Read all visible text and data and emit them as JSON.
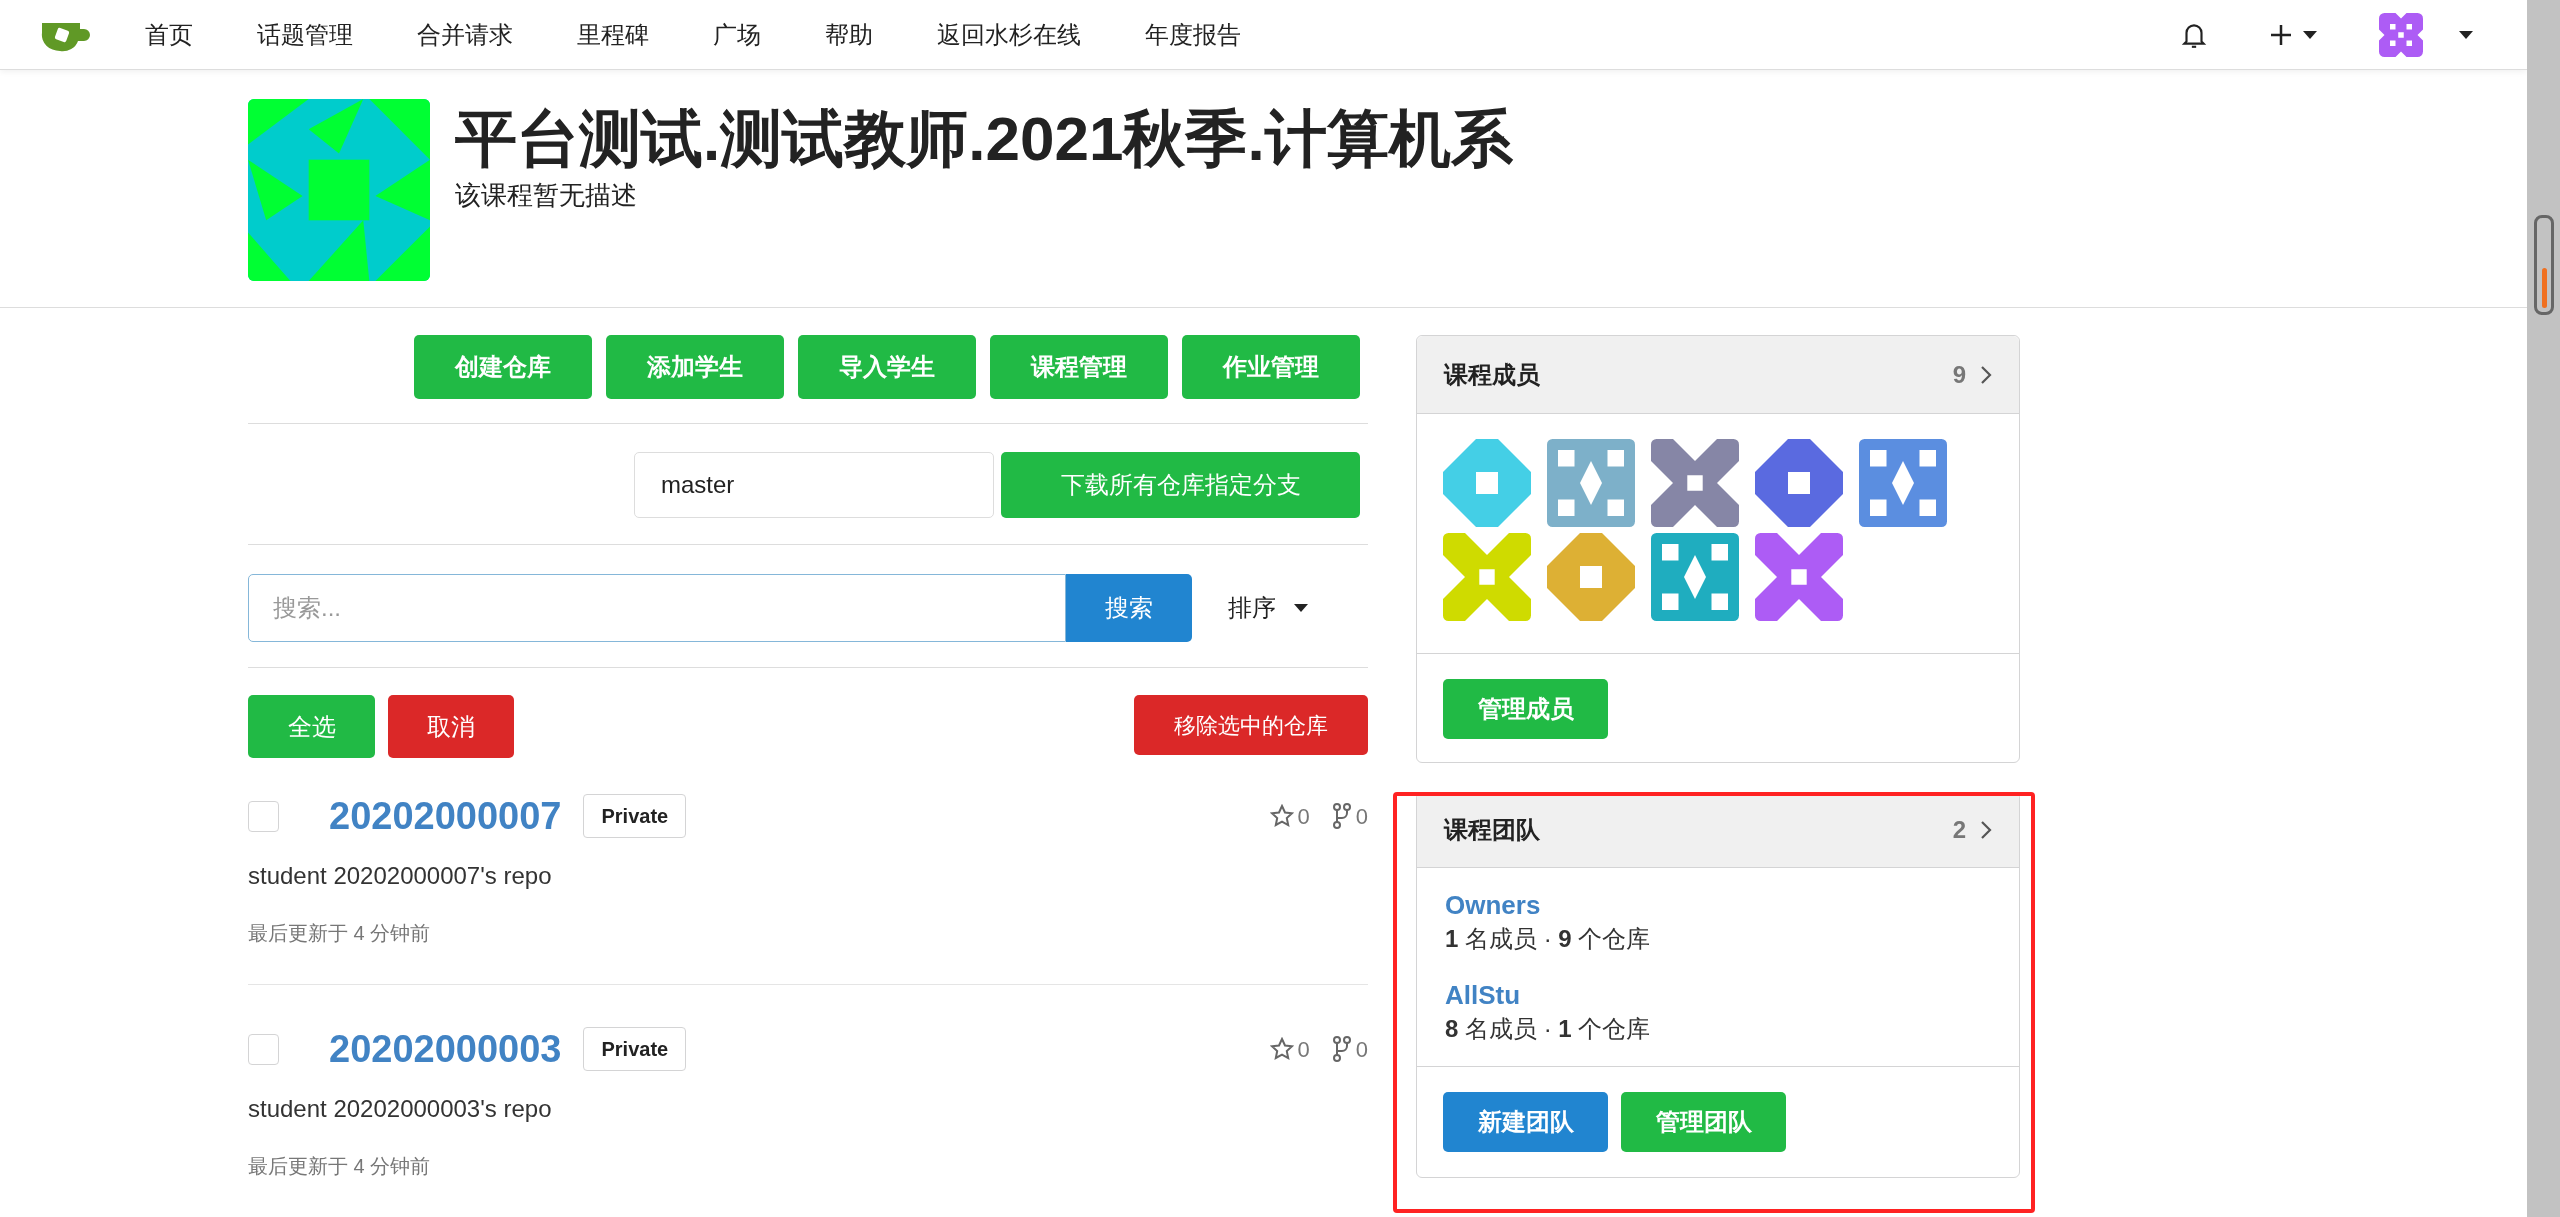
{
  "nav": {
    "items": [
      "首页",
      "话题管理",
      "合并请求",
      "里程碑",
      "广场",
      "帮助",
      "返回水杉在线",
      "年度报告"
    ]
  },
  "course": {
    "title": "平台测试.测试教师.2021秋季.计算机系",
    "description": "该课程暂无描述"
  },
  "actions": [
    "创建仓库",
    "添加学生",
    "导入学生",
    "课程管理",
    "作业管理"
  ],
  "branch": {
    "value": "master",
    "button": "下载所有仓库指定分支"
  },
  "search": {
    "placeholder": "搜索...",
    "button": "搜索",
    "sort": "排序"
  },
  "bulk": {
    "select_all": "全选",
    "cancel": "取消",
    "remove": "移除选中的仓库"
  },
  "repos": [
    {
      "name": "20202000007",
      "visibility": "Private",
      "checked": false,
      "stars": "0",
      "forks": "0",
      "description": "student 20202000007's repo",
      "updated": "最后更新于 4 分钟前"
    },
    {
      "name": "20202000003",
      "visibility": "Private",
      "checked": false,
      "stars": "0",
      "forks": "0",
      "description": "student 20202000003's repo",
      "updated": "最后更新于 4 分钟前"
    }
  ],
  "members": {
    "title": "课程成员",
    "count": "9",
    "avatars": [
      {
        "color": "#44cfe6"
      },
      {
        "color": "#7db0c9"
      },
      {
        "color": "#8686a6"
      },
      {
        "color": "#5a6ae0"
      },
      {
        "color": "#5b8ee0"
      },
      {
        "color": "#cfdb00"
      },
      {
        "color": "#ddb034"
      },
      {
        "color": "#1fadbf"
      },
      {
        "color": "#ad5cf5"
      }
    ],
    "button": "管理成员"
  },
  "teams": {
    "title": "课程团队",
    "count": "2",
    "items": [
      {
        "name": "Owners",
        "stats": "**1** 名成员 · **9** 个仓库"
      },
      {
        "name": "AllStu",
        "stats": "**8** 名成员 · **1** 个仓库"
      }
    ],
    "buttons": [
      {
        "label": "新建团队",
        "kind": "primary"
      },
      {
        "label": "管理团队",
        "kind": "positive"
      }
    ]
  }
}
